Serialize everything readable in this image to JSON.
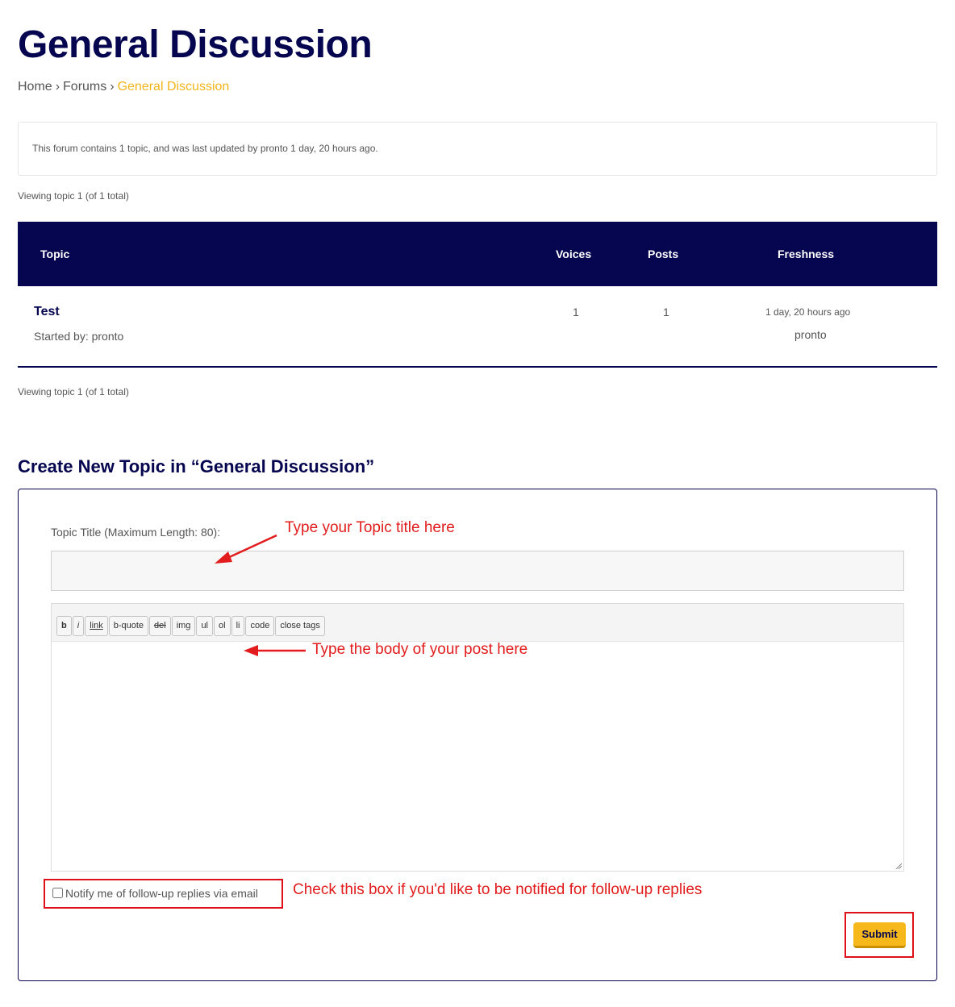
{
  "page": {
    "title": "General Discussion"
  },
  "breadcrumb": {
    "home": "Home",
    "separator": "›",
    "forums": "Forums",
    "current": "General Discussion"
  },
  "forum_info": {
    "text": "This forum contains 1 topic, and was last updated by  pronto 1 day, 20 hours ago."
  },
  "pagination": {
    "top": "Viewing topic 1 (of 1 total)",
    "bottom": "Viewing topic 1 (of 1 total)"
  },
  "table": {
    "headers": {
      "topic": "Topic",
      "voices": "Voices",
      "posts": "Posts",
      "freshness": "Freshness"
    },
    "rows": [
      {
        "title": "Test",
        "started_by": "Started by:  pronto",
        "voices": "1",
        "posts": "1",
        "freshness_time": "1 day, 20 hours ago",
        "freshness_user": "pronto"
      }
    ]
  },
  "new_topic": {
    "heading": "Create New Topic in “General Discussion”",
    "title_label": "Topic Title (Maximum Length: 80):",
    "title_value": "",
    "body_value": "",
    "toolbar": [
      "b",
      "i",
      "link",
      "b-quote",
      "del",
      "img",
      "ul",
      "ol",
      "li",
      "code",
      "close tags"
    ],
    "notify_label": "Notify me of follow-up replies via email",
    "notify_checked": false,
    "submit_label": "Submit"
  },
  "annotations": {
    "title_note": "Type your Topic title here",
    "body_note": "Type the body of your post here",
    "notify_note": "Check this box if you'd like to be notified for follow-up replies"
  },
  "colors": {
    "navy": "#050550",
    "accent_yellow": "#f3b51b",
    "annotation_red": "#e21c1c"
  }
}
